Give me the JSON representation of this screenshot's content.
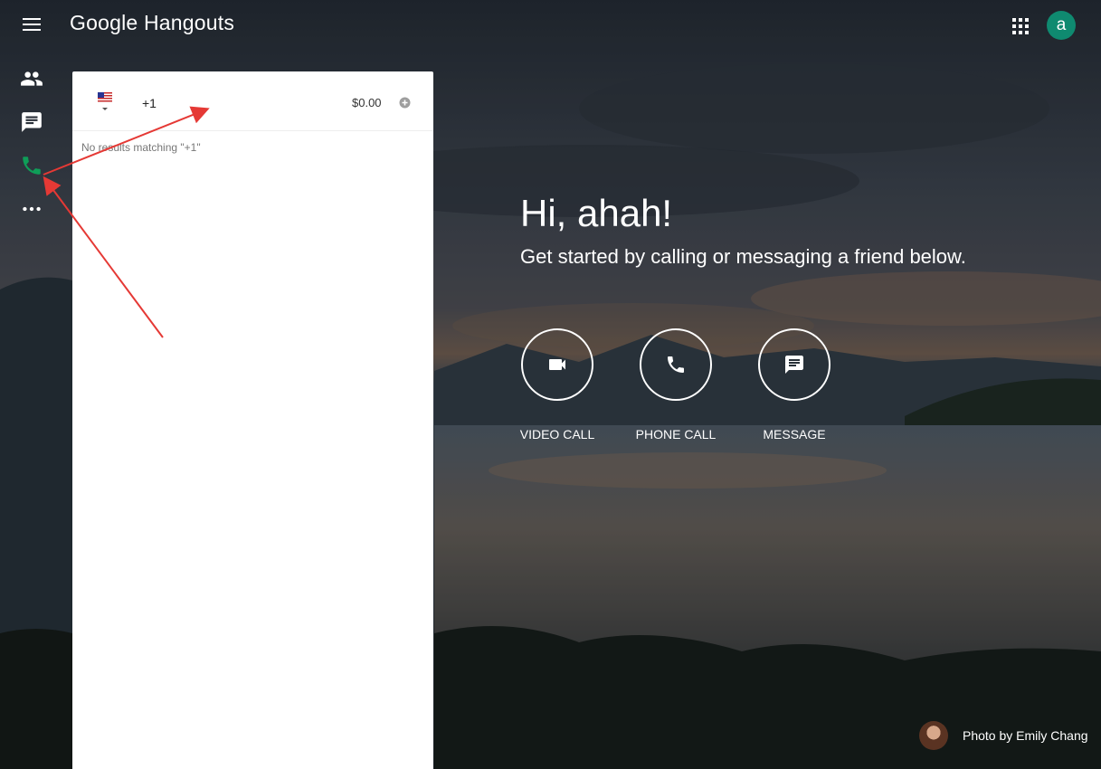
{
  "header": {
    "app_title": "Google Hangouts",
    "avatar_letter": "a"
  },
  "rail": {
    "items": [
      {
        "icon": "contacts-icon",
        "label": "Contacts"
      },
      {
        "icon": "chat-icon",
        "label": "Conversations"
      },
      {
        "icon": "phone-icon",
        "label": "Phone calls",
        "active": true
      },
      {
        "icon": "more-icon",
        "label": "More"
      }
    ]
  },
  "dialer": {
    "country_flag": "flag-us-icon",
    "number_value": "+1",
    "credit": "$0.00",
    "no_results": "No results matching \"+1\""
  },
  "welcome": {
    "greeting": "Hi, ahah!",
    "subtitle": "Get started by calling or messaging a friend below."
  },
  "actions": [
    {
      "label": "VIDEO CALL",
      "icon": "videocam-icon"
    },
    {
      "label": "PHONE CALL",
      "icon": "phone-icon"
    },
    {
      "label": "MESSAGE",
      "icon": "message-icon"
    }
  ],
  "photo_credit": "Photo by Emily Chang",
  "colors": {
    "accent_green": "#0f9d58",
    "avatar_bg": "#0f8a70",
    "annotation_red": "#e53935"
  }
}
